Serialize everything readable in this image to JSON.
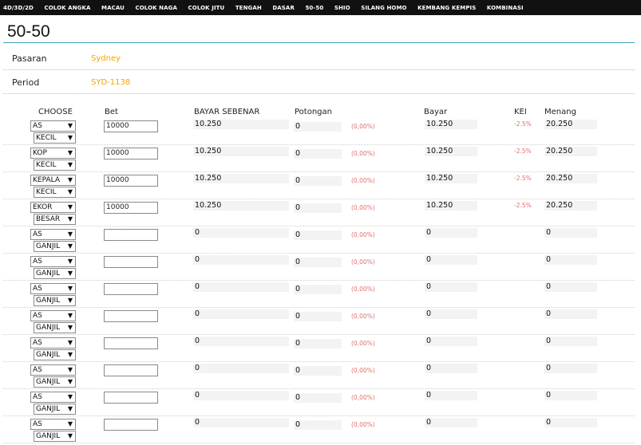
{
  "nav": {
    "items": [
      "4D/3D/2D",
      "COLOK ANGKA",
      "MACAU",
      "COLOK NAGA",
      "COLOK JITU",
      "TENGAH",
      "DASAR",
      "50-50",
      "SHIO",
      "SILANG HOMO",
      "KEMBANG KEMPIS",
      "KOMBINASI"
    ]
  },
  "page": {
    "title": "50-50"
  },
  "info": {
    "pasaran_label": "Pasaran",
    "pasaran_value": "Sydney",
    "period_label": "Period",
    "period_value": "SYD-1138"
  },
  "columns": {
    "choose": "CHOOSE",
    "bet": "Bet",
    "bayar_sebenar": "BAYAR SEBENAR",
    "potongan": "Potongan",
    "bayar": "Bayar",
    "kei": "KEI",
    "menang": "Menang"
  },
  "rows": [
    {
      "choose": "AS",
      "option": "KECIL",
      "bet": "10000",
      "bayar_sebenar": "10.250",
      "potongan": "0",
      "potongan_pct": "(0,00%)",
      "bayar": "10.250",
      "kei": "-2.5%",
      "menang": "20.250"
    },
    {
      "choose": "KOP",
      "option": "KECIL",
      "bet": "10000",
      "bayar_sebenar": "10.250",
      "potongan": "0",
      "potongan_pct": "(0,00%)",
      "bayar": "10.250",
      "kei": "-2.5%",
      "menang": "20.250"
    },
    {
      "choose": "KEPALA",
      "option": "KECIL",
      "bet": "10000",
      "bayar_sebenar": "10.250",
      "potongan": "0",
      "potongan_pct": "(0,00%)",
      "bayar": "10.250",
      "kei": "-2.5%",
      "menang": "20.250"
    },
    {
      "choose": "EKOR",
      "option": "BESAR",
      "bet": "10000",
      "bayar_sebenar": "10.250",
      "potongan": "0",
      "potongan_pct": "(0,00%)",
      "bayar": "10.250",
      "kei": "-2.5%",
      "menang": "20.250"
    },
    {
      "choose": "AS",
      "option": "GANJIL",
      "bet": "",
      "bayar_sebenar": "0",
      "potongan": "0",
      "potongan_pct": "(0,00%)",
      "bayar": "0",
      "kei": "",
      "menang": "0"
    },
    {
      "choose": "AS",
      "option": "GANJIL",
      "bet": "",
      "bayar_sebenar": "0",
      "potongan": "0",
      "potongan_pct": "(0,00%)",
      "bayar": "0",
      "kei": "",
      "menang": "0"
    },
    {
      "choose": "AS",
      "option": "GANJIL",
      "bet": "",
      "bayar_sebenar": "0",
      "potongan": "0",
      "potongan_pct": "(0,00%)",
      "bayar": "0",
      "kei": "",
      "menang": "0"
    },
    {
      "choose": "AS",
      "option": "GANJIL",
      "bet": "",
      "bayar_sebenar": "0",
      "potongan": "0",
      "potongan_pct": "(0,00%)",
      "bayar": "0",
      "kei": "",
      "menang": "0"
    },
    {
      "choose": "AS",
      "option": "GANJIL",
      "bet": "",
      "bayar_sebenar": "0",
      "potongan": "0",
      "potongan_pct": "(0,00%)",
      "bayar": "0",
      "kei": "",
      "menang": "0"
    },
    {
      "choose": "AS",
      "option": "GANJIL",
      "bet": "",
      "bayar_sebenar": "0",
      "potongan": "0",
      "potongan_pct": "(0,00%)",
      "bayar": "0",
      "kei": "",
      "menang": "0"
    },
    {
      "choose": "AS",
      "option": "GANJIL",
      "bet": "",
      "bayar_sebenar": "0",
      "potongan": "0",
      "potongan_pct": "(0,00%)",
      "bayar": "0",
      "kei": "",
      "menang": "0"
    },
    {
      "choose": "AS",
      "option": "GANJIL",
      "bet": "",
      "bayar_sebenar": "0",
      "potongan": "0",
      "potongan_pct": "(0,00%)",
      "bayar": "0",
      "kei": "",
      "menang": "0"
    }
  ]
}
